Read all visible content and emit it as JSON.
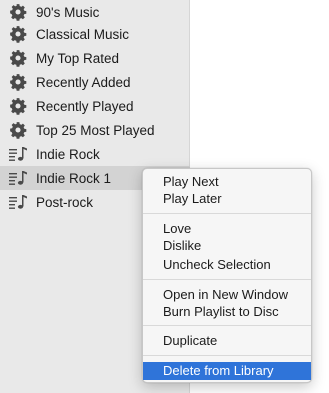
{
  "sidebar": {
    "items": [
      {
        "label": "90's Music",
        "icon": "gear-icon"
      },
      {
        "label": "Classical Music",
        "icon": "gear-icon"
      },
      {
        "label": "My Top Rated",
        "icon": "gear-icon"
      },
      {
        "label": "Recently Added",
        "icon": "gear-icon"
      },
      {
        "label": "Recently Played",
        "icon": "gear-icon"
      },
      {
        "label": "Top 25 Most Played",
        "icon": "gear-icon"
      },
      {
        "label": "Indie Rock",
        "icon": "playlist-icon"
      },
      {
        "label": "Indie Rock 1",
        "icon": "playlist-icon",
        "selected": true
      },
      {
        "label": "Post-rock",
        "icon": "playlist-icon"
      }
    ]
  },
  "context_menu": {
    "items": [
      {
        "label": "Play Next"
      },
      {
        "label": "Play Later"
      },
      {
        "label": "Love"
      },
      {
        "label": "Dislike"
      },
      {
        "label": "Uncheck Selection"
      },
      {
        "label": "Open in New Window"
      },
      {
        "label": "Burn Playlist to Disc"
      },
      {
        "label": "Duplicate"
      },
      {
        "label": "Delete from Library",
        "highlighted": true
      }
    ]
  },
  "colors": {
    "sidebar_bg": "#e9e9e9",
    "selected_row_bg": "#d3d3d3",
    "menu_highlight": "#2f74d9"
  }
}
